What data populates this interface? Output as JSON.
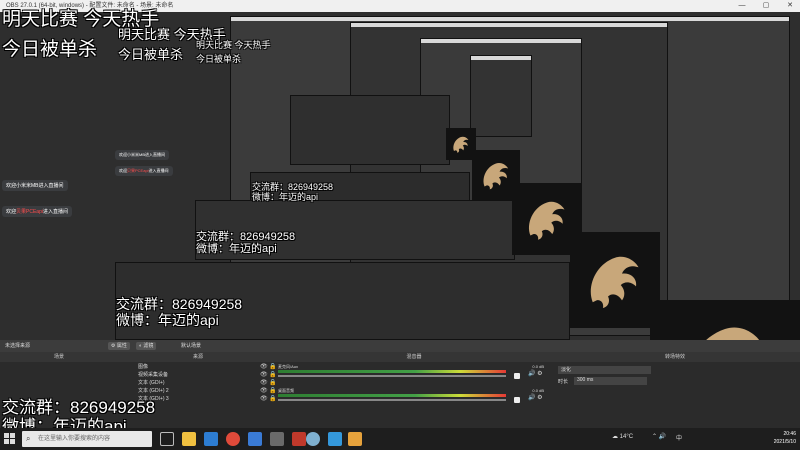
{
  "window": {
    "title": "OBS 27.0.1 (64-bit, windows) - 配置文件: 未命名 - 场景: 未命名",
    "controls": [
      "—",
      "▢",
      "✕"
    ]
  },
  "overlay": {
    "line1": "明天比赛 今天热手",
    "line2": "今日被单杀",
    "group_line1": "交流群：826949258",
    "group_line2": "微博：年迈的api",
    "chat1_prefix": "欢迎",
    "chat1_name": "小米米MB",
    "chat1_suffix": "进入直播间",
    "chat2_prefix": "欢迎",
    "chat2_name": "贝果PCEapi",
    "chat2_suffix": "进入直播间"
  },
  "obs": {
    "strip": {
      "no_source": "未选择来源",
      "properties": "属性",
      "filters": "滤镜",
      "scene_label": "默认场景"
    },
    "panels": {
      "scenes": "场景",
      "sources": "来源",
      "mixer": "混音器",
      "transitions": "转场特效"
    },
    "sources": [
      {
        "label": "图像"
      },
      {
        "label": "视频采集设备"
      },
      {
        "label": "文本 (GDI+)"
      },
      {
        "label": "文本 (GDI+) 2"
      },
      {
        "label": "文本 (GDI+) 3"
      }
    ],
    "mixer": [
      {
        "label": "麦克风/Aux",
        "db": "0.0 dB"
      },
      {
        "label": "桌面音频",
        "db": "0.0 dB"
      }
    ],
    "transitions": {
      "type": "淡化",
      "duration_label": "时长",
      "duration_value": "300 ms"
    }
  },
  "taskbar": {
    "search_placeholder": "在这里输入你要搜索的内容",
    "weather": "14°C",
    "lang": "中",
    "time": "20:46",
    "date": "2021/5/10"
  },
  "colors": {
    "logo_gold": "#c8a77a",
    "chat_name_red": "#ff4d4d"
  }
}
